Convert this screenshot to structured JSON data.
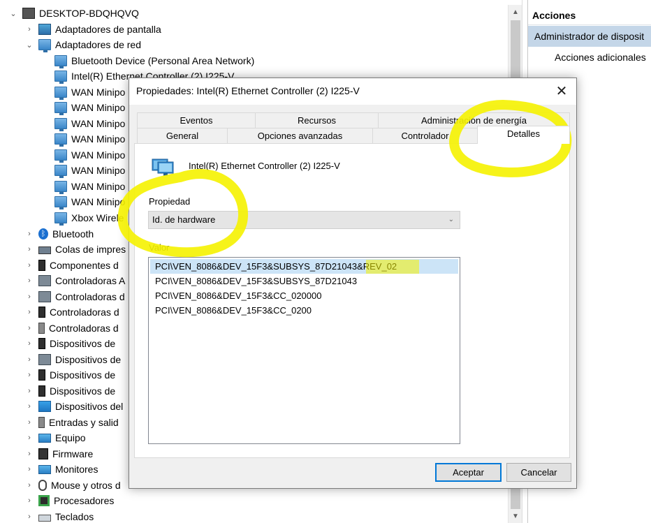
{
  "tree": {
    "root": "DESKTOP-BDQHQVQ",
    "items": [
      {
        "label": "Adaptadores de pantalla",
        "icon": "display-adapter-icon"
      },
      {
        "label": "Adaptadores de red",
        "icon": "network-adapter-icon"
      },
      {
        "label": "Bluetooth Device (Personal Area Network)",
        "icon": "network-adapter-icon"
      },
      {
        "label": "Intel(R) Ethernet Controller (2) I225-V",
        "icon": "network-adapter-icon"
      },
      {
        "label": "WAN Minipo",
        "icon": "network-adapter-icon"
      },
      {
        "label": "WAN Minipo",
        "icon": "network-adapter-icon"
      },
      {
        "label": "WAN Minipo",
        "icon": "network-adapter-icon"
      },
      {
        "label": "WAN Minipo",
        "icon": "network-adapter-icon"
      },
      {
        "label": "WAN Minipo",
        "icon": "network-adapter-icon"
      },
      {
        "label": "WAN Minipo",
        "icon": "network-adapter-icon"
      },
      {
        "label": "WAN Minipo",
        "icon": "network-adapter-icon"
      },
      {
        "label": "WAN Minipo",
        "icon": "network-adapter-icon"
      },
      {
        "label": "Xbox Wirele",
        "icon": "network-adapter-icon"
      },
      {
        "label": "Bluetooth",
        "icon": "bluetooth-icon"
      },
      {
        "label": "Colas de impres",
        "icon": "printer-icon"
      },
      {
        "label": "Componentes d",
        "icon": "software-component-icon"
      },
      {
        "label": "Controladoras A",
        "icon": "storage-controller-icon"
      },
      {
        "label": "Controladoras d",
        "icon": "storage-controller-icon"
      },
      {
        "label": "Controladoras d",
        "icon": "usb-controller-icon"
      },
      {
        "label": "Controladoras d",
        "icon": "audio-controller-icon"
      },
      {
        "label": "Dispositivos de",
        "icon": "usb-device-icon"
      },
      {
        "label": "Dispositivos de",
        "icon": "imaging-device-icon"
      },
      {
        "label": "Dispositivos de",
        "icon": "system-device-icon"
      },
      {
        "label": "Dispositivos de",
        "icon": "memory-device-icon"
      },
      {
        "label": "Dispositivos del",
        "icon": "system-folder-icon"
      },
      {
        "label": "Entradas y salid",
        "icon": "audio-io-icon"
      },
      {
        "label": "Equipo",
        "icon": "computer-icon"
      },
      {
        "label": "Firmware",
        "icon": "firmware-icon"
      },
      {
        "label": "Monitores",
        "icon": "monitor-icon"
      },
      {
        "label": "Mouse y otros d",
        "icon": "mouse-icon"
      },
      {
        "label": "Procesadores",
        "icon": "processor-icon"
      },
      {
        "label": "Teclados",
        "icon": "keyboard-icon"
      }
    ]
  },
  "actions": {
    "title": "Acciones",
    "selected": "Administrador de disposit",
    "more": "Acciones adicionales"
  },
  "dialog": {
    "title": "Propiedades: Intel(R) Ethernet Controller (2) I225-V",
    "close_symbol": "✕",
    "tabs_back": [
      "Eventos",
      "Recursos",
      "Administración de energía"
    ],
    "tabs_front": [
      "General",
      "Opciones avanzadas",
      "Controlador",
      "Detalles"
    ],
    "active_tab": "Detalles",
    "device_name": "Intel(R) Ethernet Controller (2) I225-V",
    "property_label": "Propiedad",
    "property_value": "Id. de hardware",
    "value_label": "Valor",
    "values": [
      "PCI\\VEN_8086&DEV_15F3&SUBSYS_87D21043&REV_02",
      "PCI\\VEN_8086&DEV_15F3&SUBSYS_87D21043",
      "PCI\\VEN_8086&DEV_15F3&CC_020000",
      "PCI\\VEN_8086&DEV_15F3&CC_0200"
    ],
    "ok_label": "Aceptar",
    "cancel_label": "Cancelar"
  },
  "colors": {
    "highlight": "#f5f200",
    "selection": "#cce4f7",
    "accent": "#0078d7",
    "actions_selected_bg": "#c4d6e8"
  }
}
